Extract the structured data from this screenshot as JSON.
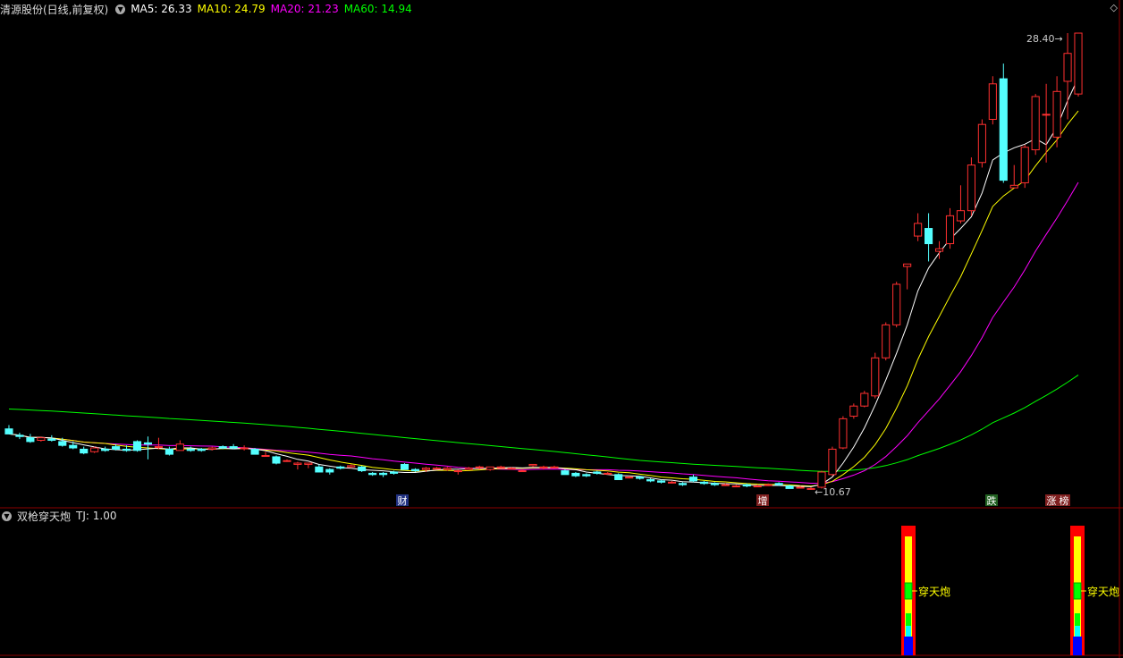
{
  "main_panel": {
    "title": "清源股份(日线,前复权)",
    "indicators": [
      {
        "label": "MA5: 26.33",
        "color": "#ffffff"
      },
      {
        "label": "MA10: 24.79",
        "color": "#ffff00"
      },
      {
        "label": "MA20: 21.23",
        "color": "#ff00ff"
      },
      {
        "label": "MA60: 14.94",
        "color": "#00ff00"
      }
    ],
    "high_label": "28.40",
    "low_label": "10.67"
  },
  "sub_panel": {
    "title": "双枪穿天炮",
    "value": "TJ: 1.00",
    "signal_label": "穿天炮"
  },
  "colors": {
    "up": "#ff3030",
    "down": "#54ffff",
    "ma5": "#ffffff",
    "ma10": "#ffff00",
    "ma20": "#ff00ff",
    "ma60": "#00ff00",
    "grid": "#8b0000"
  },
  "chart_data": {
    "type": "candlestick",
    "y_range": [
      10.5,
      29
    ],
    "candles": [
      [
        12.8,
        12.95,
        12.6,
        12.6
      ],
      [
        12.55,
        12.65,
        12.4,
        12.5
      ],
      [
        12.45,
        12.6,
        12.25,
        12.3
      ],
      [
        12.35,
        12.5,
        12.3,
        12.45
      ],
      [
        12.4,
        12.55,
        12.3,
        12.35
      ],
      [
        12.3,
        12.45,
        12.1,
        12.15
      ],
      [
        12.15,
        12.3,
        12.0,
        12.05
      ],
      [
        12.0,
        12.1,
        11.8,
        11.85
      ],
      [
        11.9,
        12.1,
        11.85,
        12.05
      ],
      [
        12.0,
        12.1,
        11.9,
        11.95
      ],
      [
        12.1,
        12.2,
        11.95,
        12.0
      ],
      [
        12.0,
        12.15,
        11.9,
        11.95
      ],
      [
        12.3,
        12.35,
        11.9,
        11.95
      ],
      [
        12.25,
        12.5,
        11.6,
        12.2
      ],
      [
        12.1,
        12.45,
        12.0,
        12.1
      ],
      [
        12.0,
        12.1,
        11.75,
        11.8
      ],
      [
        11.95,
        11.96,
        12.35,
        12.2
      ],
      [
        12.0,
        12.1,
        11.9,
        11.95
      ],
      [
        12.0,
        12.05,
        11.9,
        11.95
      ],
      [
        12.0,
        12.1,
        11.95,
        12.05
      ],
      [
        12.1,
        12.15,
        12.0,
        12.05
      ],
      [
        12.1,
        12.2,
        12.0,
        12.05
      ],
      [
        12.05,
        12.15,
        11.95,
        12.05
      ],
      [
        12.0,
        12.05,
        11.8,
        11.8
      ],
      [
        11.75,
        11.9,
        11.7,
        11.75
      ],
      [
        11.7,
        11.75,
        11.4,
        11.45
      ],
      [
        11.55,
        11.6,
        11.5,
        11.55
      ],
      [
        11.4,
        11.5,
        11.2,
        11.45
      ],
      [
        11.4,
        11.45,
        11.25,
        11.45
      ],
      [
        11.3,
        11.4,
        11.1,
        11.1
      ],
      [
        11.2,
        11.25,
        11.0,
        11.1
      ],
      [
        11.3,
        11.35,
        11.2,
        11.25
      ],
      [
        11.3,
        11.4,
        11.25,
        11.35
      ],
      [
        11.3,
        11.35,
        11.1,
        11.15
      ],
      [
        11.05,
        11.1,
        10.95,
        11.0
      ],
      [
        11.05,
        11.1,
        10.9,
        11.0
      ],
      [
        11.1,
        11.15,
        11.0,
        11.05
      ],
      [
        11.4,
        11.45,
        11.2,
        11.2
      ],
      [
        11.2,
        11.25,
        11.1,
        11.15
      ],
      [
        11.2,
        11.3,
        11.1,
        11.25
      ],
      [
        11.25,
        11.3,
        11.2,
        11.25
      ],
      [
        11.2,
        11.3,
        11.15,
        11.25
      ],
      [
        11.15,
        11.2,
        11.0,
        11.15
      ],
      [
        11.2,
        11.3,
        11.2,
        11.25
      ],
      [
        11.3,
        11.35,
        11.2,
        11.3
      ],
      [
        11.2,
        11.3,
        11.15,
        11.3
      ],
      [
        11.3,
        11.35,
        11.25,
        11.3
      ],
      [
        11.25,
        11.3,
        11.2,
        11.25
      ],
      [
        11.15,
        11.2,
        11.1,
        11.15
      ],
      [
        11.35,
        11.4,
        11.3,
        11.4
      ],
      [
        11.3,
        11.35,
        11.2,
        11.3
      ],
      [
        11.3,
        11.35,
        11.25,
        11.3
      ],
      [
        11.15,
        11.2,
        11.0,
        11.0
      ],
      [
        11.05,
        11.1,
        10.9,
        10.95
      ],
      [
        11.0,
        11.05,
        10.9,
        10.95
      ],
      [
        11.1,
        11.15,
        11.0,
        11.05
      ],
      [
        11.05,
        11.1,
        11.0,
        11.05
      ],
      [
        11.0,
        11.05,
        10.8,
        10.8
      ],
      [
        10.9,
        10.95,
        10.85,
        10.9
      ],
      [
        10.9,
        10.95,
        10.8,
        10.85
      ],
      [
        10.8,
        10.85,
        10.7,
        10.75
      ],
      [
        10.75,
        10.8,
        10.65,
        10.7
      ],
      [
        10.7,
        10.75,
        10.65,
        10.7
      ],
      [
        10.65,
        10.7,
        10.55,
        10.6
      ],
      [
        10.9,
        11.0,
        10.7,
        10.75
      ],
      [
        10.7,
        10.75,
        10.6,
        10.65
      ],
      [
        10.65,
        10.7,
        10.55,
        10.6
      ],
      [
        10.6,
        10.65,
        10.55,
        10.6
      ],
      [
        10.55,
        10.6,
        10.5,
        10.55
      ],
      [
        10.6,
        10.65,
        10.5,
        10.55
      ],
      [
        10.55,
        10.6,
        10.5,
        10.55
      ],
      [
        10.6,
        10.65,
        10.55,
        10.6
      ],
      [
        10.65,
        10.7,
        10.55,
        10.6
      ],
      [
        10.55,
        10.6,
        10.45,
        10.45
      ],
      [
        10.5,
        10.55,
        10.45,
        10.5
      ],
      [
        10.45,
        10.5,
        10.4,
        10.45
      ],
      [
        10.5,
        11.15,
        10.45,
        11.1
      ],
      [
        11.0,
        12.1,
        10.95,
        12.0
      ],
      [
        12.05,
        13.3,
        12.0,
        13.2
      ],
      [
        13.3,
        13.8,
        13.2,
        13.7
      ],
      [
        13.7,
        14.3,
        13.65,
        14.2
      ],
      [
        14.1,
        15.8,
        14.0,
        15.6
      ],
      [
        15.6,
        17.0,
        15.5,
        16.9
      ],
      [
        16.9,
        18.6,
        16.8,
        18.5
      ],
      [
        19.2,
        19.3,
        18.3,
        19.3
      ],
      [
        20.4,
        21.3,
        20.2,
        20.9
      ],
      [
        20.7,
        21.3,
        19.4,
        20.1
      ],
      [
        19.8,
        20.2,
        19.5,
        19.9
      ],
      [
        20.1,
        21.5,
        19.9,
        21.2
      ],
      [
        21.0,
        22.4,
        20.9,
        21.4
      ],
      [
        21.4,
        23.5,
        21.2,
        23.2
      ],
      [
        23.3,
        25.0,
        23.1,
        24.8
      ],
      [
        25.0,
        26.7,
        24.8,
        26.4
      ],
      [
        26.6,
        27.2,
        22.5,
        22.6
      ],
      [
        22.3,
        23.2,
        22.3,
        22.4
      ],
      [
        22.5,
        24.0,
        22.3,
        23.9
      ],
      [
        23.8,
        26.0,
        23.6,
        25.9
      ],
      [
        25.2,
        26.4,
        23.3,
        25.2
      ],
      [
        24.3,
        26.7,
        23.9,
        26.1
      ],
      [
        26.5,
        28.4,
        25.0,
        27.6
      ],
      [
        26.0,
        28.4,
        25.9,
        28.4
      ]
    ]
  }
}
